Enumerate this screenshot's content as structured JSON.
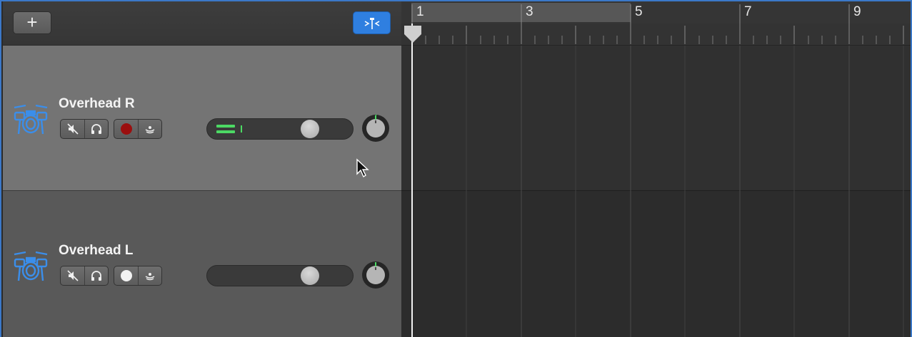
{
  "toolbar": {
    "add_label": "+",
    "add_icon": "plus-icon",
    "smart_controls_icon": "smart-controls-icon",
    "accent": "#2f7fe0"
  },
  "tracks": [
    {
      "name": "Overhead R",
      "icon": "drum-kit-icon",
      "selected": true,
      "mute_icon": "mute-icon",
      "solo_icon": "headphones-icon",
      "record_enable_color": "#9b0f0f",
      "input_monitor_icon": "input-monitor-icon",
      "volume_level": 0.72,
      "meter_active": true
    },
    {
      "name": "Overhead L",
      "icon": "drum-kit-icon",
      "selected": false,
      "mute_icon": "mute-icon",
      "solo_icon": "headphones-icon",
      "record_enable_color": "#f2f2f2",
      "input_monitor_icon": "input-monitor-icon",
      "volume_level": 0.72,
      "meter_active": false
    }
  ],
  "ruler": {
    "bars": [
      "1",
      "3",
      "5",
      "7",
      "9"
    ],
    "cycle_range": [
      "1",
      "5"
    ]
  },
  "colors": {
    "track_icon": "#3b8eea",
    "meter_green": "#4cd964",
    "pan_ring_green": "#4cd964"
  }
}
